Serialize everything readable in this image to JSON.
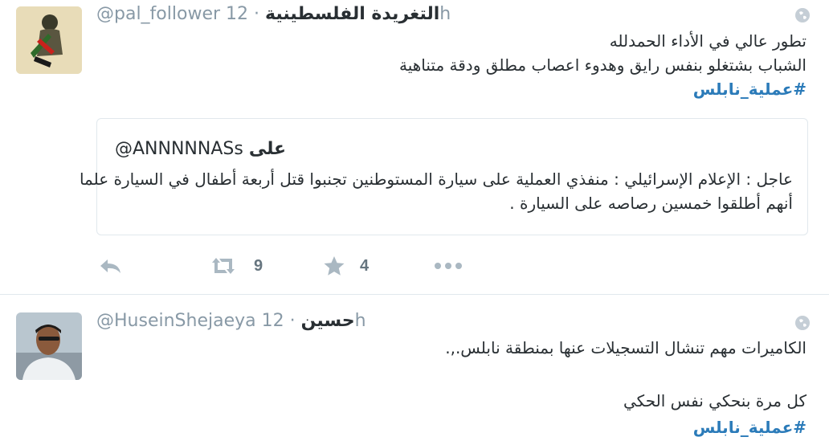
{
  "tweets": [
    {
      "handle": "@pal_follower",
      "name": "التغريدة الفلسطينية",
      "time": "12h",
      "lines": [
        "تطور عالي في الأداء الحمدلله",
        "الشباب بشتغلو بنفس رايق وهدوء اعصاب مطلق ودقة متناهية"
      ],
      "hashtag": "#عملية_نابلس",
      "quote": {
        "handle": "@ANNNNNASs",
        "name": "على",
        "lines": [
          "عاجل : الإعلام الإسرائيلي : منفذي العملية على سيارة المستوطنين تجنبوا قتل أربعة أطفال في السيارة علما",
          "أنهم أطلقوا خمسين رصاصه على السيارة ."
        ]
      },
      "actions": {
        "retweet_count": "9",
        "favorite_count": "4"
      }
    },
    {
      "handle": "@HuseinShejaeya",
      "name": "حسين",
      "time": "12h",
      "lines": [
        "الكاميرات مهم تنشال التسجيلات عنها بمنطقة نابلس.,.",
        "",
        "كل مرة بنحكي نفس الحكي"
      ],
      "hashtag": "#عملية_نابلس"
    }
  ],
  "icons": {
    "reply": "reply-icon",
    "retweet": "retweet-icon",
    "favorite": "star-icon",
    "more": "more-dots-icon",
    "globe": "globe-icon"
  },
  "colors": {
    "hashtag": "#2b7bb9",
    "meta": "#8899a6",
    "action_icon": "#aab8c2",
    "text": "#292f33"
  }
}
